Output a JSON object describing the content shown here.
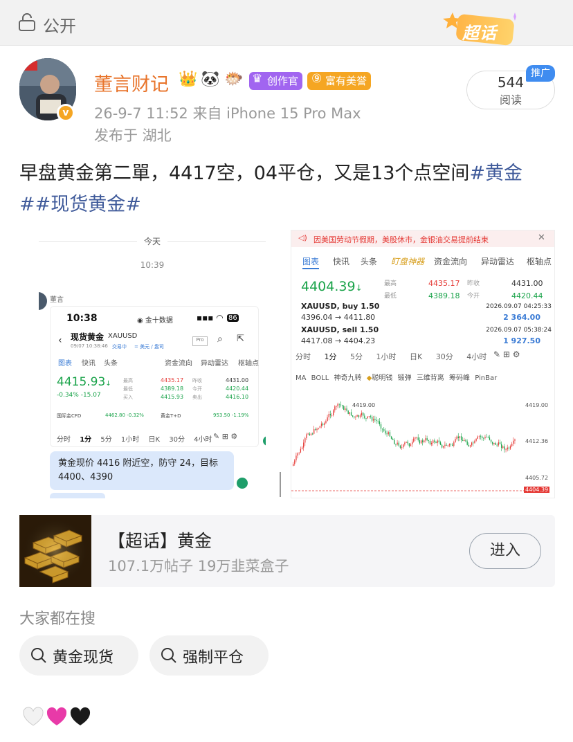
{
  "topbar": {
    "privacy": "公开",
    "super_topic_badge": "超话"
  },
  "author": {
    "name": "董言财记",
    "badges": [
      "创作官",
      "富有美誉"
    ],
    "meta": "26-9-7 11:52  来自 iPhone 15 Pro Max",
    "location": "发布于 湖北",
    "reads_count": "544",
    "reads_label": "阅读",
    "promo_label": "推广"
  },
  "post": {
    "text": "早盘黄金第二單，4417空，04平仓，又是13个点空间",
    "tag1": "#黄金#",
    "tag2": "#现货黄金#"
  },
  "image1": {
    "date_sep": "今天",
    "time_sep": "10:39",
    "sender": "董言",
    "status_time": "10:38",
    "app_name": "金十数据",
    "battery": "86",
    "title": "现货黄金",
    "symbol": "XAUUSD",
    "subline": "09/07 10:38:46",
    "tag_trading": "交易中",
    "tag_region": "= 美元 / 盎司",
    "tab1": "图表",
    "tab2": "快讯",
    "tab3": "头条",
    "tab4": "资金流向",
    "tab5": "异动雷达",
    "tab6": "枢轴点",
    "price": "4415.93",
    "change": "-0.34%  -15.07",
    "high_l": "最高",
    "high_v": "4435.17",
    "low_l": "最低",
    "low_v": "4389.18",
    "buy_l": "买入",
    "buy_v": "4415.93",
    "prev_l": "昨收",
    "prev_v": "4431.00",
    "open_l": "今开",
    "open_v": "4420.44",
    "sell_l": "卖出",
    "sell_v": "4416.10",
    "cfd_l": "国际金CFD",
    "cfd_v": "4462.80  -0.32%",
    "td_l": "黄金T+D",
    "td_v": "953.50  -1.19%",
    "periods": [
      "分时",
      "1分",
      "5分",
      "1小时",
      "日K",
      "30分",
      "4小时"
    ],
    "message": "黄金现价 4416 附近空，防守 24，目标 4400、4390"
  },
  "image2": {
    "notice": "因美国劳动节假期，美股休市，金银油交易提前结束",
    "tab1": "图表",
    "tab2": "快讯",
    "tab3": "头条",
    "tab4": "盯盘神器",
    "tab5": "资金流向",
    "tab6": "异动雷达",
    "tab7": "枢轴点",
    "price": "4404.39",
    "high_l": "最高",
    "high_v": "4435.17",
    "low_l": "最低",
    "low_v": "4389.18",
    "prev_l": "昨收",
    "prev_v": "4431.00",
    "open_l": "今开",
    "open_v": "4420.44",
    "trade1_sym": "XAUUSD, buy 1.50",
    "trade1_time": "2026.09.07 04:25:33",
    "trade1_route": "4396.04 → 4411.80",
    "trade1_pl": "2 364.00",
    "trade2_sym": "XAUUSD, sell 1.50",
    "trade2_time": "2026.09.07 05:38:24",
    "trade2_route": "4417.08 → 4404.23",
    "trade2_pl": "1 927.50",
    "periods": [
      "分时",
      "1分",
      "5分",
      "1小时",
      "日K",
      "30分",
      "4小时"
    ],
    "indicators": [
      "MA",
      "BOLL",
      "神奇九转",
      "聪明钱",
      "锻弹",
      "三维背离",
      "筹码峰",
      "PinBar"
    ],
    "high_mark": "4419.00",
    "axis": [
      "4419.00",
      "4412.36",
      "4405.72"
    ],
    "last_price": "4404.39"
  },
  "card": {
    "title": "【超话】黄金",
    "sub": "107.1万帖子 19万韭菜盒子",
    "enter": "进入"
  },
  "searches": {
    "heading": "大家都在搜",
    "items": [
      "黄金现货",
      "强制平仓"
    ]
  },
  "colors": {
    "accent": "#e8742b",
    "link": "#3f5a9a",
    "up": "#e53935",
    "down": "#1aa34a"
  }
}
